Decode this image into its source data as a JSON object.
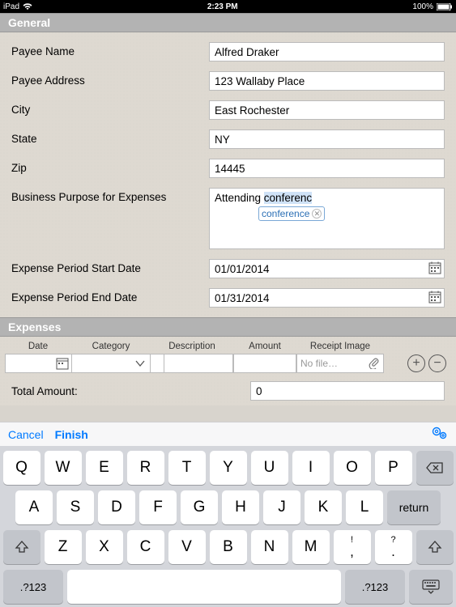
{
  "status": {
    "carrier": "iPad",
    "wifi": "wifi",
    "time": "2:23 PM",
    "battery_pct": "100%"
  },
  "sections": {
    "general": "General",
    "expenses": "Expenses"
  },
  "form": {
    "payee_name": {
      "label": "Payee Name",
      "value": "Alfred Draker"
    },
    "payee_address": {
      "label": "Payee Address",
      "value": "123 Wallaby Place"
    },
    "city": {
      "label": "City",
      "value": "East Rochester"
    },
    "state": {
      "label": "State",
      "value": "NY"
    },
    "zip": {
      "label": "Zip",
      "value": "14445"
    },
    "purpose": {
      "label": "Business Purpose for Expenses",
      "value_pre": "Attending ",
      "value_sel": "conferenc",
      "suggestion": "conference"
    },
    "start_date": {
      "label": "Expense Period Start Date",
      "value": "01/01/2014"
    },
    "end_date": {
      "label": "Expense Period End Date",
      "value": "01/31/2014"
    }
  },
  "expense_cols": {
    "date": "Date",
    "category": "Category",
    "description": "Description",
    "amount": "Amount",
    "receipt": "Receipt Image"
  },
  "expense_row": {
    "file_placeholder": "No file…"
  },
  "total": {
    "label": "Total Amount:",
    "value": "0"
  },
  "toolbar": {
    "cancel": "Cancel",
    "finish": "Finish"
  },
  "keyboard": {
    "row1": [
      "Q",
      "W",
      "E",
      "R",
      "T",
      "Y",
      "U",
      "I",
      "O",
      "P"
    ],
    "row2": [
      "A",
      "S",
      "D",
      "F",
      "G",
      "H",
      "J",
      "K",
      "L"
    ],
    "row3": [
      "Z",
      "X",
      "C",
      "V",
      "B",
      "N",
      "M"
    ],
    "return": "return",
    "mode": ".?123"
  }
}
